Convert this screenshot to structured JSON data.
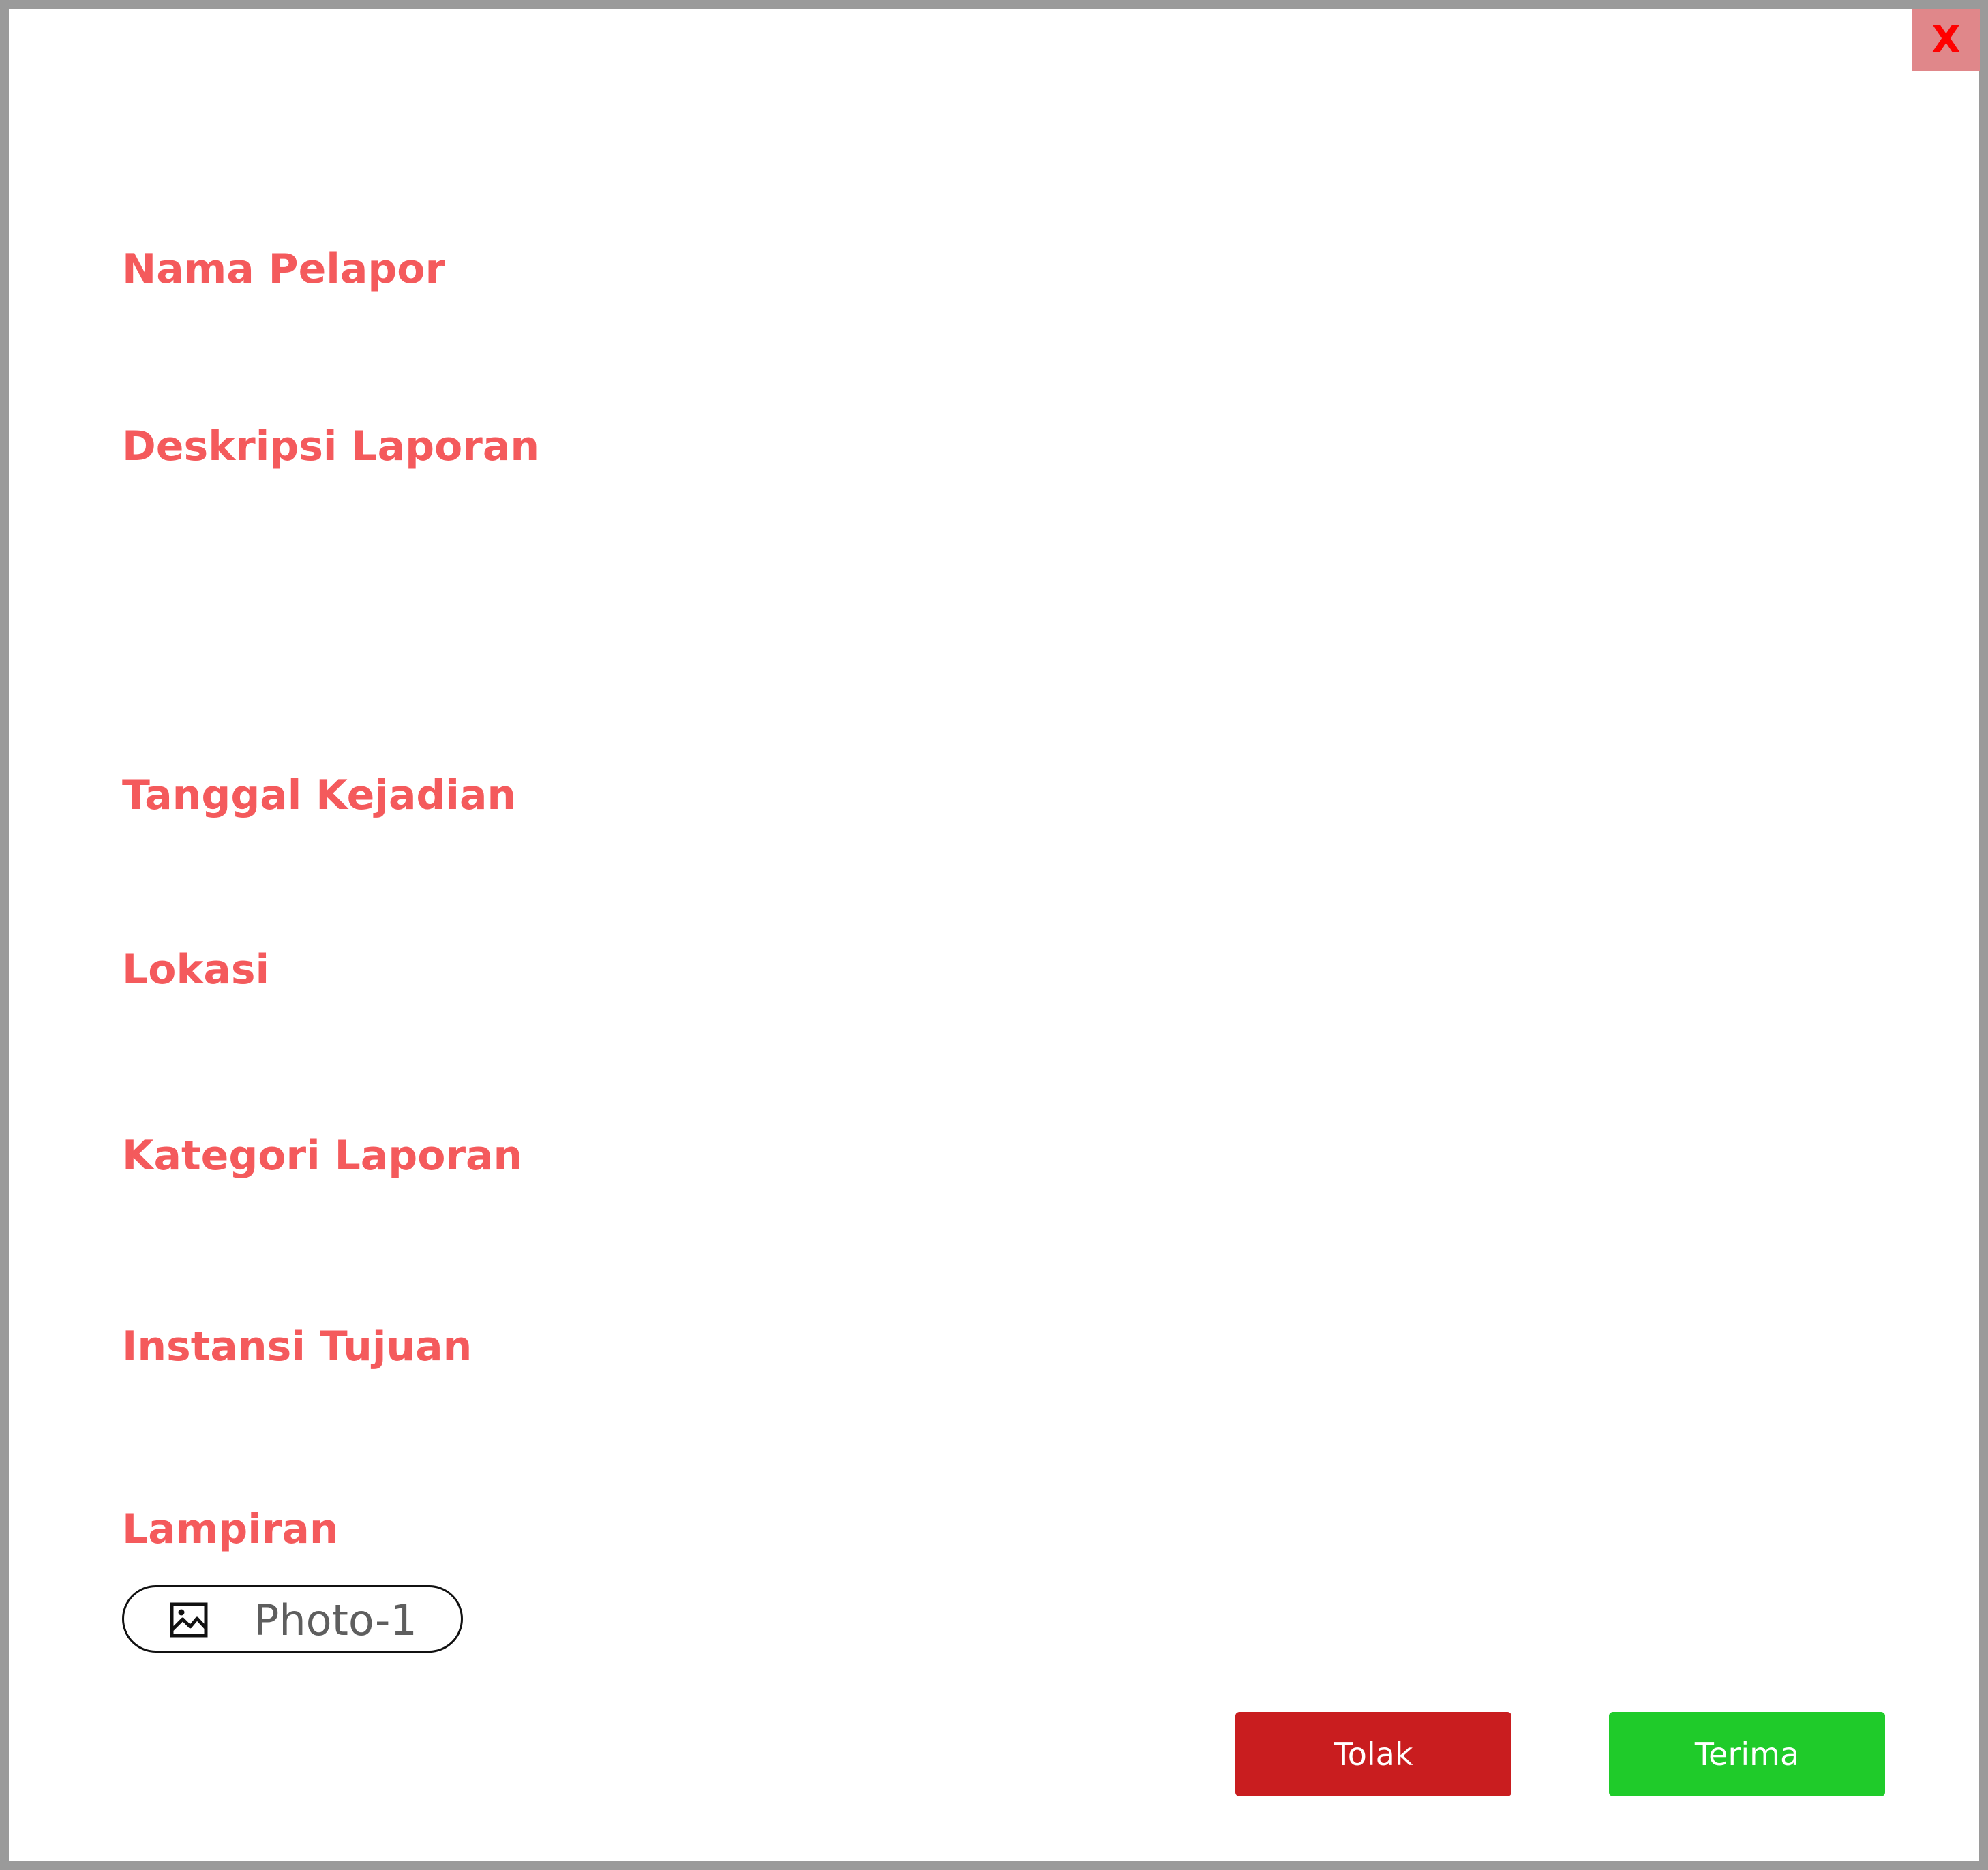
{
  "modal": {
    "close_label": "X"
  },
  "fields": {
    "reporter_name_label": "Nama Pelapor",
    "report_description_label": "Deskripsi Laporan",
    "incident_date_label": "Tanggal Kejadian",
    "location_label": "Lokasi",
    "report_category_label": "Kategori Laporan",
    "target_agency_label": "Instansi Tujuan",
    "attachment_label": "Lampiran"
  },
  "attachments": [
    {
      "label": "Photo-1",
      "icon": "image-icon"
    }
  ],
  "actions": {
    "reject_label": "Tolak",
    "accept_label": "Terima"
  },
  "colors": {
    "label": "#f45a5c",
    "reject": "#c91d1f",
    "accept": "#1fcb2a",
    "close_bg": "#e0878a",
    "close_text": "#ff0000"
  }
}
